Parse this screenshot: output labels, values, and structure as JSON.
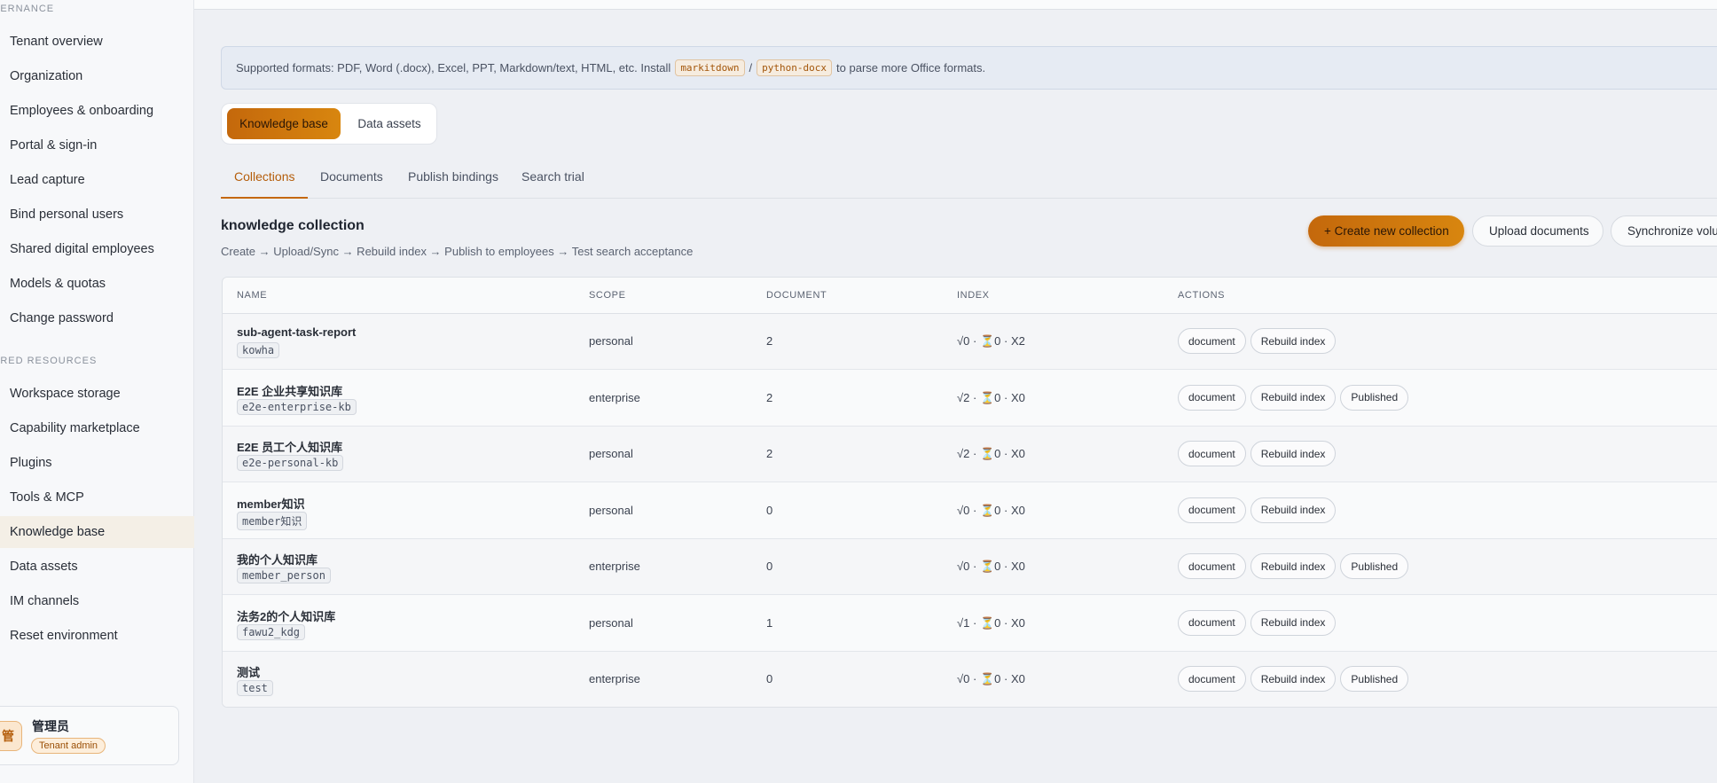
{
  "sidebar": {
    "section_governance": "VERNANCE",
    "governance_items": [
      "Tenant overview",
      "Organization",
      "Employees & onboarding",
      "Portal & sign-in",
      "Lead capture",
      "Bind personal users",
      "Shared digital employees",
      "Models & quotas",
      "Change password"
    ],
    "section_resources": "ARED RESOURCES",
    "resource_items": [
      "Workspace storage",
      "Capability marketplace",
      "Plugins",
      "Tools & MCP",
      "Knowledge base",
      "Data assets",
      "IM channels",
      "Reset environment"
    ],
    "active_item": "Knowledge base",
    "user": {
      "avatar_char": "管",
      "name": "管理员",
      "role": "Tenant admin"
    }
  },
  "notice": {
    "text_before": "Supported formats: PDF, Word (.docx), Excel, PPT, Markdown/text, HTML, etc. Install",
    "code1": "markitdown",
    "separator": "/",
    "code2": "python-docx",
    "text_after": "to parse more Office formats."
  },
  "segment": {
    "active": "Knowledge base",
    "inactive": "Data assets"
  },
  "tabs": [
    "Collections",
    "Documents",
    "Publish bindings",
    "Search trial"
  ],
  "active_tab": "Collections",
  "collection": {
    "title": "knowledge collection",
    "flow": "Create → Upload/Sync → Rebuild index → Publish to employees → Test search acceptance"
  },
  "buttons": {
    "create": "+ Create new collection",
    "upload": "Upload documents",
    "sync": "Synchronize volume"
  },
  "table": {
    "headers": [
      "NAME",
      "SCOPE",
      "DOCUMENT",
      "INDEX",
      "ACTIONS"
    ],
    "rows": [
      {
        "name": "sub-agent-task-report",
        "slug": "kowha",
        "scope": "personal",
        "documents": "2",
        "ok": "0",
        "pending": "0",
        "failed": "2",
        "actions": [
          "document",
          "Rebuild index"
        ]
      },
      {
        "name": "E2E 企业共享知识库",
        "slug": "e2e-enterprise-kb",
        "scope": "enterprise",
        "documents": "2",
        "ok": "2",
        "pending": "0",
        "failed": "0",
        "actions": [
          "document",
          "Rebuild index",
          "Published"
        ]
      },
      {
        "name": "E2E 员工个人知识库",
        "slug": "e2e-personal-kb",
        "scope": "personal",
        "documents": "2",
        "ok": "2",
        "pending": "0",
        "failed": "0",
        "actions": [
          "document",
          "Rebuild index"
        ]
      },
      {
        "name": "member知识",
        "slug": "member知识",
        "scope": "personal",
        "documents": "0",
        "ok": "0",
        "pending": "0",
        "failed": "0",
        "actions": [
          "document",
          "Rebuild index"
        ]
      },
      {
        "name": "我的个人知识库",
        "slug": "member_person",
        "scope": "enterprise",
        "documents": "0",
        "ok": "0",
        "pending": "0",
        "failed": "0",
        "actions": [
          "document",
          "Rebuild index",
          "Published"
        ]
      },
      {
        "name": "法务2的个人知识库",
        "slug": "fawu2_kdg",
        "scope": "personal",
        "documents": "1",
        "ok": "1",
        "pending": "0",
        "failed": "0",
        "actions": [
          "document",
          "Rebuild index"
        ]
      },
      {
        "name": "测试",
        "slug": "test",
        "scope": "enterprise",
        "documents": "0",
        "ok": "0",
        "pending": "0",
        "failed": "0",
        "actions": [
          "document",
          "Rebuild index",
          "Published"
        ]
      }
    ],
    "index_glyphs": {
      "ok": "√",
      "pending": "⏳",
      "failed": "X",
      "dot": "·"
    }
  },
  "colors": {
    "accent": "#c4680c",
    "accent_light": "#d8860f",
    "sidebar_active_bg": "#f4efe6",
    "page_bg": "#eef0f4"
  }
}
